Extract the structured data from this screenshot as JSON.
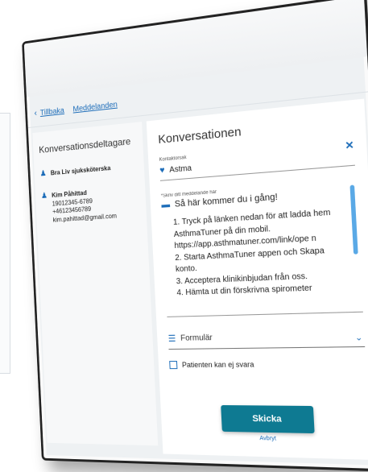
{
  "nav": {
    "back_label": "Tillbaka",
    "messages_label": "Meddelanden"
  },
  "participants": {
    "title": "Konversationsdeltagare",
    "items": [
      {
        "name": "Bra Liv sjuksköterska",
        "details": []
      },
      {
        "name": "Kim Påhittad",
        "details": [
          "19012345-6789",
          "+46123456789",
          "kim.pahittad@gmail.com"
        ]
      }
    ]
  },
  "conversation": {
    "title": "Konversationen",
    "contact_label": "Kontaktorsak",
    "contact_value": "Astma",
    "message_label": "*Skriv ditt meddelande här",
    "message_title": "Så här kommer du i gång!",
    "message_body": "1. Tryck på länken nedan för att ladda hem AsthmaTuner på din mobil. https://app.asthmatuner.com/link/ope n\n2. Starta AsthmaTuner appen och Skapa konto.\n3. Acceptera klinikinbjudan från oss.\n4. Hämta ut din förskrivna spirometer",
    "form_label": "Formulär",
    "checkbox_label": "Patienten kan ej svara",
    "send_label": "Skicka",
    "cancel_label": "Avbryt"
  }
}
